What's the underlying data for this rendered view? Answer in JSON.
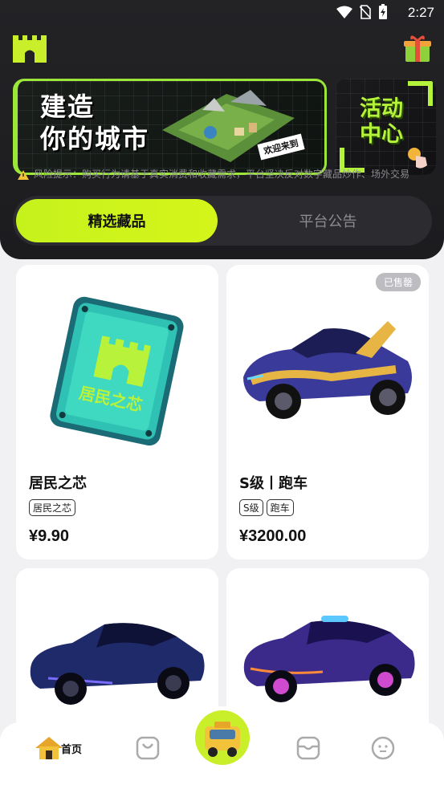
{
  "status_bar": {
    "time": "2:27"
  },
  "banner": {
    "title": "建造\n你的城市",
    "stamp": "欢迎来到",
    "side_title": "活动\n中心"
  },
  "risk_notice": "风险提示：购买行为请基于真实消费和收藏需求，平台坚决反对数字藏品炒作、场外交易",
  "tabs": [
    {
      "label": "精选藏品",
      "active": true
    },
    {
      "label": "平台公告",
      "active": false
    }
  ],
  "products": [
    {
      "name": "居民之芯",
      "tags": [
        "居民之芯"
      ],
      "price": "¥9.90",
      "sold_out": false,
      "image": "resident-core-chip-icon",
      "chip_text": "居民之芯"
    },
    {
      "name": "S级丨跑车",
      "tags": [
        "S级",
        "跑车"
      ],
      "price": "¥3200.00",
      "sold_out": true,
      "sold_label": "已售罄",
      "image": "gold-sports-car"
    },
    {
      "name": "",
      "tags": [],
      "price": "",
      "sold_out": false,
      "image": "blue-sports-car"
    },
    {
      "name": "",
      "tags": [],
      "price": "",
      "sold_out": false,
      "image": "purple-sports-car"
    }
  ],
  "bottom_nav": {
    "home_label": "首页",
    "items": [
      "home-icon",
      "bag-icon",
      "center-car-icon",
      "inbox-icon",
      "profile-icon"
    ]
  },
  "colors": {
    "accent": "#c9ef2a",
    "dark": "#1f1f22",
    "background": "#f1f1f3"
  }
}
